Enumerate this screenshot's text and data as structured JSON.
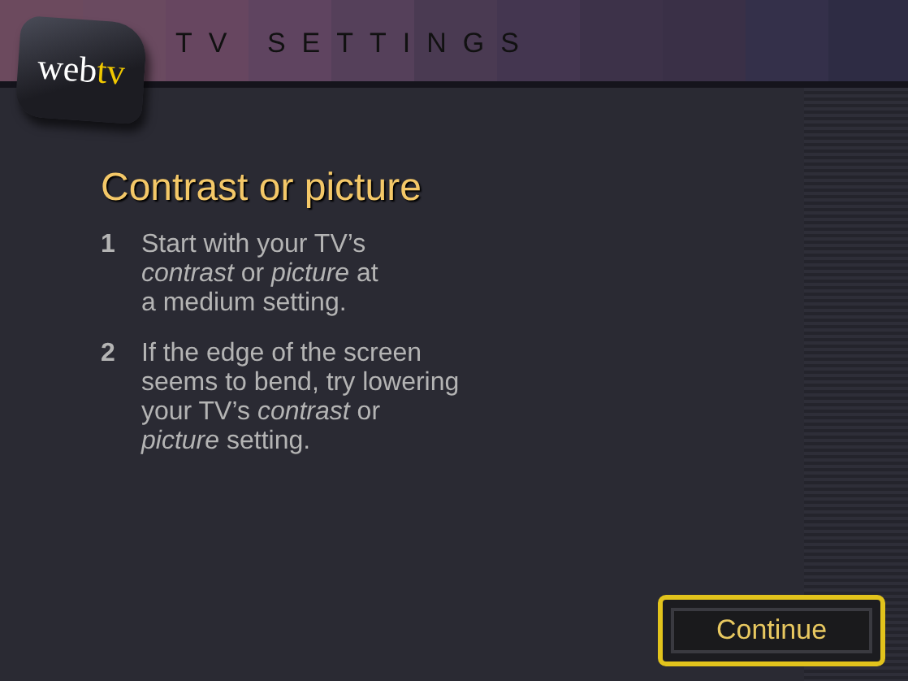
{
  "logo": {
    "text": "web",
    "accent": "tv"
  },
  "header": {
    "title": "TV SETTINGS"
  },
  "heading": "Contrast or picture",
  "steps": [
    {
      "number": "1",
      "text": "Start with your TV’s\n*contrast* or *picture* at\na medium setting."
    },
    {
      "number": "2",
      "text": "If the edge of the screen\nseems to bend, try lowering\nyour TV’s *contrast* or\n*picture* setting."
    }
  ],
  "buttons": [
    {
      "label": "Continue",
      "selected": true
    }
  ]
}
